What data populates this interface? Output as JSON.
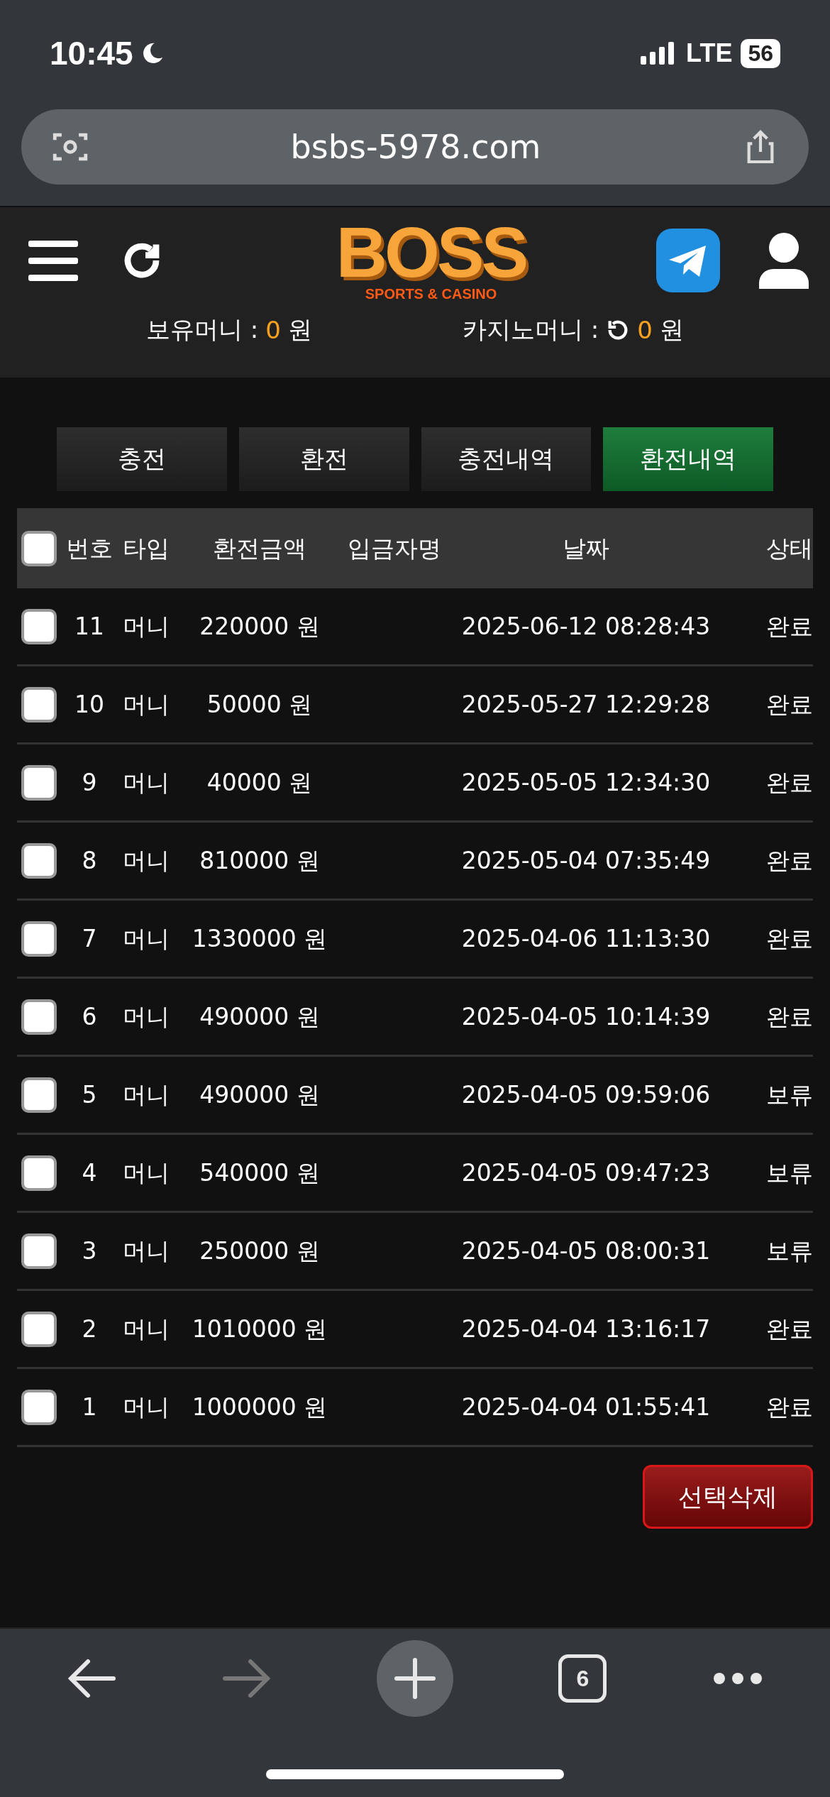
{
  "status_bar": {
    "time": "10:45",
    "network": "LTE",
    "battery": "56"
  },
  "browser": {
    "url": "bsbs-5978.com",
    "tab_count": "6",
    "forward_disabled": true
  },
  "header": {
    "logo_title": "BOSS",
    "logo_subtitle": "SPORTS & CASINO"
  },
  "balances": [
    {
      "label": "보유머니 :",
      "amount": "0",
      "unit": "원",
      "refresh": false
    },
    {
      "label": "카지노머니 :",
      "amount": "0",
      "unit": "원",
      "refresh": true
    }
  ],
  "tabs": [
    {
      "label": "충전",
      "selected": false
    },
    {
      "label": "환전",
      "selected": false
    },
    {
      "label": "충전내역",
      "selected": false
    },
    {
      "label": "환전내역",
      "selected": true
    }
  ],
  "table": {
    "select_all_checked": false,
    "columns": [
      "번호",
      "타입",
      "환전금액",
      "입금자명",
      "날짜",
      "상태"
    ],
    "rows": [
      {
        "checked": false,
        "number": "11",
        "type": "머니",
        "amount": "220000 원",
        "date": "2025-06-12 08:28:43",
        "status": "완료"
      },
      {
        "checked": false,
        "number": "10",
        "type": "머니",
        "amount": "50000 원",
        "date": "2025-05-27 12:29:28",
        "status": "완료"
      },
      {
        "checked": false,
        "number": "9",
        "type": "머니",
        "amount": "40000 원",
        "date": "2025-05-05 12:34:30",
        "status": "완료"
      },
      {
        "checked": false,
        "number": "8",
        "type": "머니",
        "amount": "810000 원",
        "date": "2025-05-04 07:35:49",
        "status": "완료"
      },
      {
        "checked": false,
        "number": "7",
        "type": "머니",
        "amount": "1330000 원",
        "date": "2025-04-06 11:13:30",
        "status": "완료"
      },
      {
        "checked": false,
        "number": "6",
        "type": "머니",
        "amount": "490000 원",
        "date": "2025-04-05 10:14:39",
        "status": "완료"
      },
      {
        "checked": false,
        "number": "5",
        "type": "머니",
        "amount": "490000 원",
        "date": "2025-04-05 09:59:06",
        "status": "보류"
      },
      {
        "checked": false,
        "number": "4",
        "type": "머니",
        "amount": "540000 원",
        "date": "2025-04-05 09:47:23",
        "status": "보류"
      },
      {
        "checked": false,
        "number": "3",
        "type": "머니",
        "amount": "250000 원",
        "date": "2025-04-05 08:00:31",
        "status": "보류"
      },
      {
        "checked": false,
        "number": "2",
        "type": "머니",
        "amount": "1010000 원",
        "date": "2025-04-04 13:16:17",
        "status": "완료"
      },
      {
        "checked": false,
        "number": "1",
        "type": "머니",
        "amount": "1000000 원",
        "date": "2025-04-04 01:55:41",
        "status": "완료"
      }
    ]
  },
  "delete_button": "선택삭제"
}
